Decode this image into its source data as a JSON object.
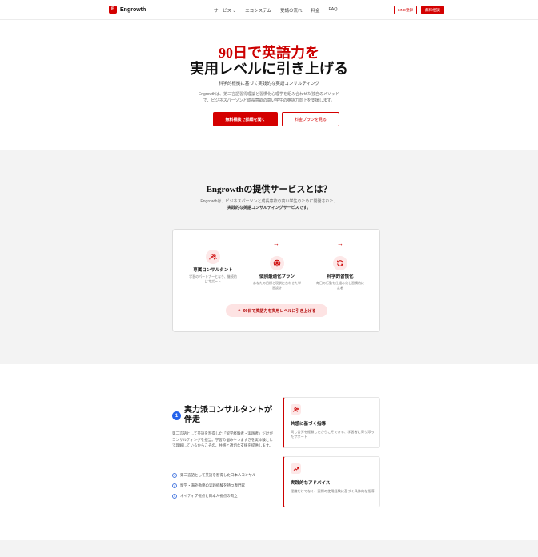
{
  "header": {
    "logo_mark": "E",
    "logo_text": "Engrowth",
    "nav": [
      "サービス ⌄",
      "エコシステム",
      "受講の流れ",
      "料金",
      "FAQ"
    ],
    "line_button": "LINE登録",
    "free_button": "無料相談"
  },
  "hero": {
    "title_line1": "90日で英語力を",
    "title_line2": "実用レベルに引き上げる",
    "subtitle": "科学的根拠に基づく実践的な英語コンサルティング",
    "desc_line1": "Engrowthは、第二言語習得理論と習慣化心理学を組み合わせた独自のメソッド",
    "desc_line2": "で、ビジネスパーソンと成長意欲の高い学生の英語力向上を支援します。",
    "primary_button": "無料相談で詳細を聞く",
    "secondary_button": "料金プランを見る"
  },
  "services": {
    "title": "Engrowthの提供サービスとは？",
    "desc_line1": "Engrowthは、ビジネスパーソンと成長意欲の高い学生のために開発された、",
    "desc_line2": "実践的な英語コンサルティングサービスです。",
    "steps": [
      {
        "title": "専属コンサルタント",
        "text": "学習のパートナーとなり、継続的にサポート"
      },
      {
        "title": "個別最適化プラン",
        "text": "あなたの目標と現状に合わせた学習設計"
      },
      {
        "title": "科学的習慣化",
        "text": "毎日の行動を仕組み化し習慣的に定着"
      }
    ],
    "pill": "90日で英語力を実用レベルに引き上げる"
  },
  "consultant": {
    "number": "1",
    "title": "実力派コンサルタントが伴走",
    "desc": "第二言語として英語を習得した「留学経験者・実践者」だけがコンサルティングを担当。学習の悩みやつまずきを実体験として理解しているからこその、共感と適切な支援を提供します。",
    "checks": [
      "第二言語として英語を習得した日本人コンサル",
      "留学・海外勤務の実践経験を持つ専門家",
      "ネイティブ視点と日本人視点の両立"
    ],
    "features": [
      {
        "title": "共感に基づく指導",
        "text": "同じ苦労を経験したからこそできる、学習者に寄り添ったサポート"
      },
      {
        "title": "実践的なアドバイス",
        "text": "理論だけでなく、実際の使用経験に基づく具体的な指導"
      }
    ]
  },
  "colors": {
    "accent": "#d40000",
    "badge_blue": "#2563eb",
    "section_bg": "#f3f3f3"
  },
  "icons": {
    "consultant": "users-icon",
    "plan": "target-icon",
    "habit": "refresh-icon",
    "arrow": "arrow-right-icon",
    "trend": "trending-up-icon"
  }
}
